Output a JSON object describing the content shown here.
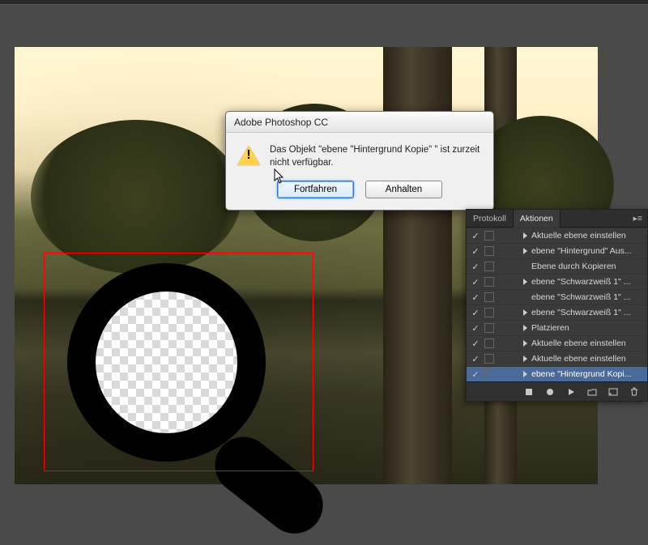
{
  "dialog": {
    "title": "Adobe Photoshop CC",
    "message": "Das Objekt \"ebene \"Hintergrund Kopie\" \" ist zurzeit nicht verfügbar.",
    "continue_label": "Fortfahren",
    "stop_label": "Anhalten"
  },
  "panel": {
    "tab_protocol": "Protokoll",
    "tab_actions": "Aktionen",
    "rows": [
      {
        "checked": true,
        "expand": true,
        "label": "Aktuelle ebene einstellen"
      },
      {
        "checked": true,
        "expand": true,
        "label": "ebene \"Hintergrund\" Aus..."
      },
      {
        "checked": true,
        "expand": false,
        "label": "Ebene durch Kopieren"
      },
      {
        "checked": true,
        "expand": true,
        "label": "ebene \"Schwarzweiß 1\" ..."
      },
      {
        "checked": true,
        "expand": false,
        "label": "ebene \"Schwarzweiß 1\" ..."
      },
      {
        "checked": true,
        "expand": true,
        "label": "ebene \"Schwarzweiß 1\" ..."
      },
      {
        "checked": true,
        "expand": true,
        "label": "Platzieren"
      },
      {
        "checked": true,
        "expand": true,
        "label": "Aktuelle ebene einstellen"
      },
      {
        "checked": true,
        "expand": true,
        "label": "Aktuelle ebene einstellen"
      },
      {
        "checked": true,
        "expand": true,
        "label": "ebene \"Hintergrund Kopi...",
        "selected": true
      }
    ]
  }
}
